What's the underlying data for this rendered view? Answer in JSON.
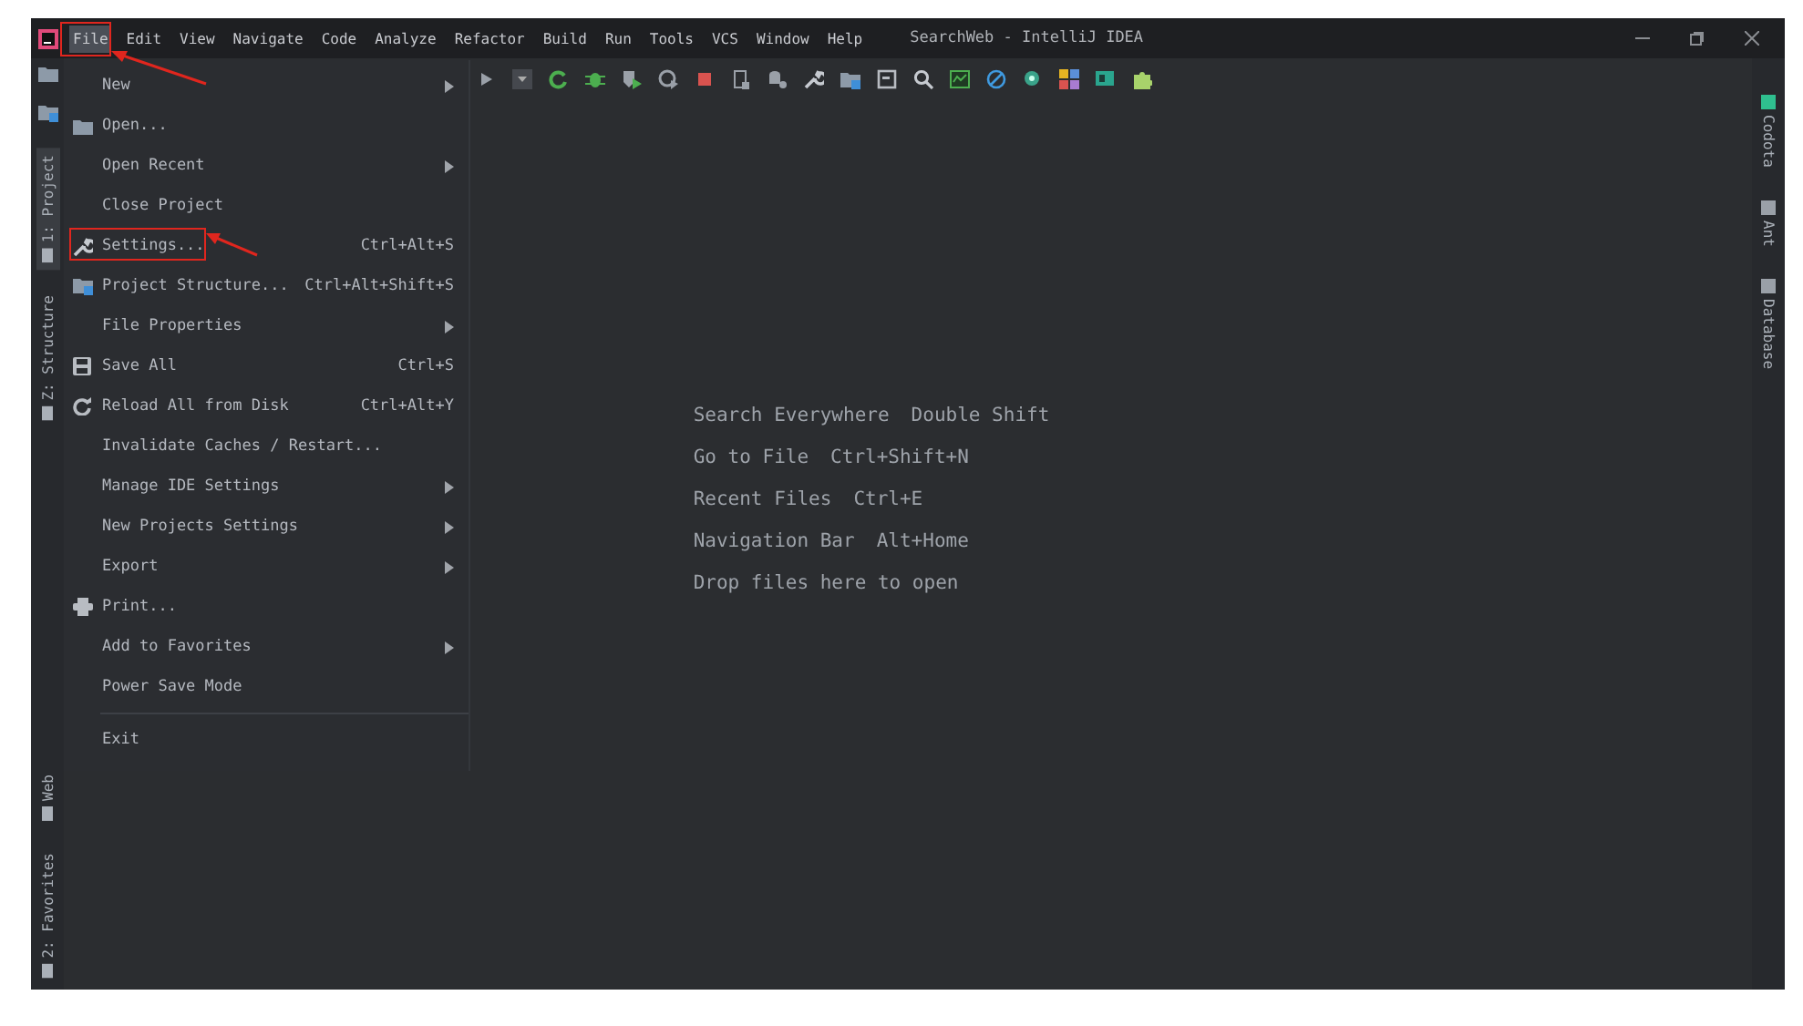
{
  "window": {
    "title": "SearchWeb - IntelliJ IDEA"
  },
  "menu_bar": [
    {
      "label": "File",
      "selected": true
    },
    {
      "label": "Edit",
      "selected": false
    },
    {
      "label": "View",
      "selected": false
    },
    {
      "label": "Navigate",
      "selected": false
    },
    {
      "label": "Code",
      "selected": false
    },
    {
      "label": "Analyze",
      "selected": false
    },
    {
      "label": "Refactor",
      "selected": false
    },
    {
      "label": "Build",
      "selected": false
    },
    {
      "label": "Run",
      "selected": false
    },
    {
      "label": "Tools",
      "selected": false
    },
    {
      "label": "VCS",
      "selected": false
    },
    {
      "label": "Window",
      "selected": false
    },
    {
      "label": "Help",
      "selected": false
    }
  ],
  "file_menu": [
    {
      "kind": "item",
      "label": "New",
      "submenu": true
    },
    {
      "kind": "item",
      "label": "Open...",
      "submenu": false
    },
    {
      "kind": "item",
      "label": "Open Recent",
      "submenu": true
    },
    {
      "kind": "item",
      "label": "Close Project",
      "submenu": false
    },
    {
      "kind": "item",
      "label": "Settings...",
      "shortcut": "Ctrl+Alt+S",
      "submenu": false
    },
    {
      "kind": "item",
      "label": "Project Structure...",
      "shortcut": "Ctrl+Alt+Shift+S",
      "submenu": false
    },
    {
      "kind": "item",
      "label": "File Properties",
      "submenu": true
    },
    {
      "kind": "item",
      "label": "Save All",
      "shortcut": "Ctrl+S",
      "submenu": false
    },
    {
      "kind": "item",
      "label": "Reload All from Disk",
      "shortcut": "Ctrl+Alt+Y",
      "submenu": false
    },
    {
      "kind": "item",
      "label": "Invalidate Caches / Restart...",
      "submenu": false
    },
    {
      "kind": "item",
      "label": "Manage IDE Settings",
      "submenu": true
    },
    {
      "kind": "item",
      "label": "New Projects Settings",
      "submenu": true
    },
    {
      "kind": "item",
      "label": "Export",
      "submenu": true
    },
    {
      "kind": "item",
      "label": "Print...",
      "submenu": false
    },
    {
      "kind": "item",
      "label": "Add to Favorites",
      "submenu": true
    },
    {
      "kind": "item",
      "label": "Power Save Mode",
      "submenu": false
    },
    {
      "kind": "separator"
    },
    {
      "kind": "item",
      "label": "Exit",
      "submenu": false
    }
  ],
  "left_tool_tabs": [
    {
      "label": "1: Project",
      "selected": true
    },
    {
      "label": "Z: Structure",
      "selected": false
    },
    {
      "label": "Web",
      "selected": false
    },
    {
      "label": "2: Favorites",
      "selected": false
    }
  ],
  "right_tool_tabs": [
    {
      "label": "Codota",
      "selected": false
    },
    {
      "label": "Ant",
      "selected": false
    },
    {
      "label": "Database",
      "selected": false
    }
  ],
  "welcome_hints": [
    {
      "action": "Search Everywhere",
      "shortcut": "Double Shift"
    },
    {
      "action": "Go to File",
      "shortcut": "Ctrl+Shift+N"
    },
    {
      "action": "Recent Files",
      "shortcut": "Ctrl+E"
    },
    {
      "action": "Navigation Bar",
      "shortcut": "Alt+Home"
    }
  ],
  "drop_hint": "Drop files here to open"
}
